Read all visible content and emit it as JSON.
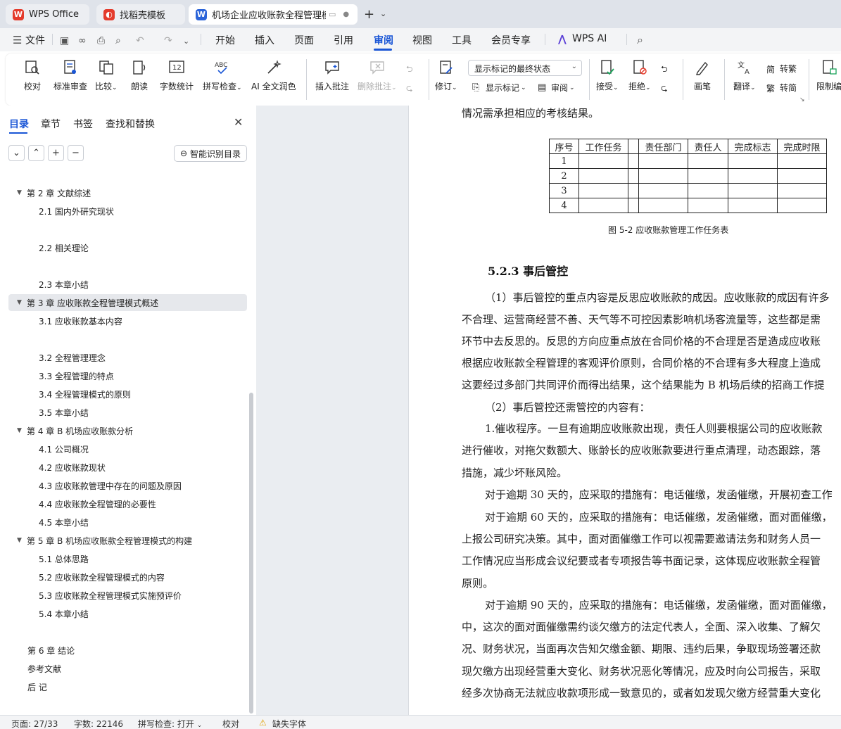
{
  "tabs": [
    {
      "label": "WPS Office",
      "color": "#e43b2c"
    },
    {
      "label": "找稻壳模板",
      "color": "#e43b2c"
    },
    {
      "label": "机场企业应收账款全程管理模",
      "color": "#2b64d9"
    }
  ],
  "menu": {
    "file": "文件",
    "items": [
      "开始",
      "插入",
      "页面",
      "引用",
      "审阅",
      "视图",
      "工具",
      "会员专享"
    ],
    "active": "审阅",
    "wps_ai": "WPS AI"
  },
  "ribbon": {
    "proofread": "校对",
    "standard_review": "标准审查",
    "compare": "比较",
    "read_aloud": "朗读",
    "word_count": "字数统计",
    "spell_check": "拼写检查",
    "ai_polish": "AI 全文润色",
    "insert_comment": "插入批注",
    "delete_comment": "删除批注",
    "track_changes": "修订",
    "markup_select": "显示标记的最终状态",
    "show_markup": "显示标记",
    "review_pane": "审阅",
    "accept": "接受",
    "reject": "拒绝",
    "ink": "画笔",
    "translate": "翻译",
    "to_simplified": "转繁",
    "to_traditional": "转简",
    "restrict_edit": "限制编"
  },
  "left_panel": {
    "tabs": [
      "目录",
      "章节",
      "书签",
      "查找和替换"
    ],
    "smart_toc": "智能识别目录",
    "toc": [
      {
        "label": "第 2 章  文献综述",
        "level": 1,
        "expanded": true
      },
      {
        "label": "2.1 国内外研究现状",
        "level": 2
      },
      {
        "label": "2.2 相关理论",
        "level": 2
      },
      {
        "label": "2.3 本章小结",
        "level": 2
      },
      {
        "label": "第 3 章  应收账款全程管理模式概述",
        "level": 1,
        "expanded": true,
        "selected": true
      },
      {
        "label": "3.1 应收账款基本内容",
        "level": 2
      },
      {
        "label": "3.2 全程管理理念",
        "level": 2
      },
      {
        "label": "3.3 全程管理的特点",
        "level": 2
      },
      {
        "label": "3.4 全程管理模式的原则",
        "level": 2
      },
      {
        "label": "3.5 本章小结",
        "level": 2
      },
      {
        "label": "第 4 章  B 机场应收账款分析",
        "level": 1,
        "expanded": true
      },
      {
        "label": "4.1  公司概况",
        "level": 2
      },
      {
        "label": "4.2  应收账款现状",
        "level": 2
      },
      {
        "label": "4.3  应收账款管理中存在的问题及原因",
        "level": 2
      },
      {
        "label": "4.4  应收账款全程管理的必要性",
        "level": 2
      },
      {
        "label": "4.5  本章小结",
        "level": 2
      },
      {
        "label": "第 5 章 B 机场应收账款全程管理模式的构建",
        "level": 1,
        "expanded": true
      },
      {
        "label": "5.1  总体思路",
        "level": 2
      },
      {
        "label": "5.2  应收账款全程管理模式的内容",
        "level": 2
      },
      {
        "label": "5.3  应收账款全程管理模式实施预评价",
        "level": 2
      },
      {
        "label": "5.4  本章小结",
        "level": 2
      },
      {
        "label": "第 6 章  结论",
        "level": 1
      },
      {
        "label": "参考文献",
        "level": 1
      },
      {
        "label": "后  记",
        "level": 1
      }
    ]
  },
  "document": {
    "intro_line": "情况需承担相应的考核结果。",
    "table": {
      "headers": [
        "序号",
        "工作任务",
        "",
        "责任部门",
        "责任人",
        "完成标志",
        "完成时限"
      ],
      "rows": [
        "1",
        "2",
        "3",
        "4"
      ]
    },
    "caption": "图 5-2  应收账款管理工作任务表",
    "heading": "5.2.3 事后管控",
    "lines": [
      "（1）事后管控的重点内容是反思应收账款的成因。应收账款的成因有许多",
      "不合理、运营商经营不善、天气等不可控因素影响机场客流量等，这些都是需",
      "环节中去反思的。反思的方向应重点放在合同价格的不合理是否是造成应收账",
      "根据应收账款全程管理的客观评价原则，合同价格的不合理有多大程度上造成",
      "这要经过多部门共同评价而得出结果，这个结果能为 B 机场后续的招商工作提",
      "（2）事后管控还需管控的内容有：",
      "1.催收程序。一旦有逾期应收账款出现，责任人则要根据公司的应收账款",
      "进行催收，对拖欠数额大、账龄长的应收账款要进行重点清理，动态跟踪，落",
      "措施，减少坏账风险。",
      "对于逾期 30 天的，应采取的措施有：电话催缴，发函催缴，开展初查工作",
      "对于逾期 60 天的，应采取的措施有：电话催缴，发函催缴，面对面催缴，",
      "上报公司研究决策。其中，面对面催缴工作可以视需要邀请法务和财务人员一",
      "工作情况应当形成会议纪要或者专项报告等书面记录，这体现应收账款全程管",
      "原则。",
      "对于逾期 90 天的，应采取的措施有：电话催缴，发函催缴，面对面催缴，",
      "中，这次的面对面催缴需约谈欠缴方的法定代表人，全面、深入收集、了解欠",
      "况、财务状况，当面再次告知欠缴金额、期限、违约后果，争取现场签署还款",
      "现欠缴方出现经营重大变化、财务状况恶化等情况，应及时向公司报告，采取",
      "经多次协商无法就应收款项形成一致意见的，或者如发现欠缴方经营重大变化"
    ]
  },
  "status": {
    "page": "页面: 27/33",
    "word_count": "字数: 22146",
    "spell_check": "拼写检查: 打开",
    "proofread": "校对",
    "missing_font": "缺失字体"
  },
  "accent_color": "#1a56d6"
}
